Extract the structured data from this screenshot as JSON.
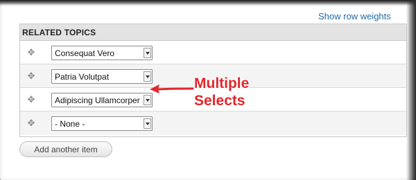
{
  "header": {
    "show_row_weights": "Show row weights"
  },
  "table": {
    "heading": "RELATED TOPICS",
    "rows": [
      {
        "handle_icon": "drag-handle-icon",
        "value": "Consequat Vero"
      },
      {
        "handle_icon": "drag-handle-icon",
        "value": "Patria Volutpat"
      },
      {
        "handle_icon": "drag-handle-icon",
        "value": "Adipiscing Ullamcorper"
      },
      {
        "handle_icon": "drag-handle-icon",
        "value": "- None -"
      }
    ]
  },
  "actions": {
    "add_another": "Add another item"
  },
  "annotation": {
    "line1": "Multiple",
    "line2": "Selects",
    "color": "#e3262a"
  },
  "colors": {
    "link": "#1f6aa7",
    "header_bg": "#e3e3e3"
  }
}
